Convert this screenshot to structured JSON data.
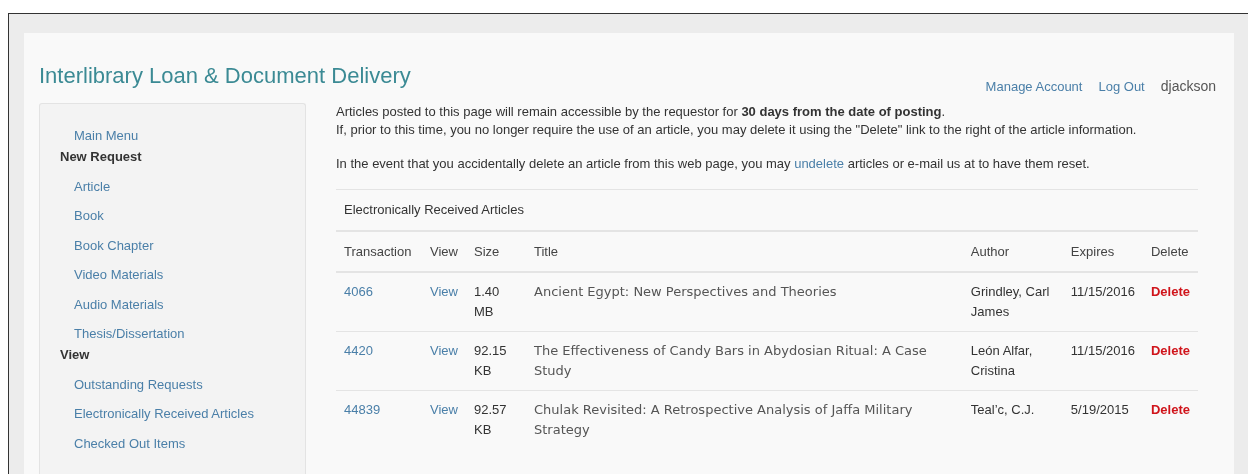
{
  "header": {
    "title": "Interlibrary Loan & Document Delivery",
    "account_links": [
      "Manage Account",
      "Log Out"
    ],
    "username": "djackson"
  },
  "sidebar": {
    "items": [
      {
        "kind": "link",
        "label": "Main Menu"
      },
      {
        "kind": "heading",
        "label": "New Request"
      },
      {
        "kind": "link",
        "label": "Article"
      },
      {
        "kind": "link",
        "label": "Book"
      },
      {
        "kind": "link",
        "label": "Book Chapter"
      },
      {
        "kind": "link",
        "label": "Video Materials"
      },
      {
        "kind": "link",
        "label": "Audio Materials"
      },
      {
        "kind": "link",
        "label": "Thesis/Dissertation"
      },
      {
        "kind": "heading",
        "label": "View"
      },
      {
        "kind": "link",
        "label": "Outstanding Requests"
      },
      {
        "kind": "link",
        "label": "Electronically Received Articles"
      },
      {
        "kind": "link",
        "label": "Checked Out Items"
      }
    ]
  },
  "intro": [
    "Articles posted to this page will remain accessible by the requestor for **30 days from the date of posting**.",
    "If, prior to this time, you no longer require the use of an article, you may delete it using the \"Delete\" link to the right of the article information."
  ],
  "notice": {
    "before": "In the event that you accidentally delete an article from this web page, you may",
    "link": "undelete",
    "after": "articles or e-mail us at to have them reset."
  },
  "table": {
    "caption": "Electronically Received Articles",
    "columns": [
      "Transaction",
      "View",
      "Size",
      "Title",
      "Author",
      "Expires",
      "Delete"
    ],
    "rows": [
      {
        "transaction": "4066",
        "view": "View",
        "size": "1.40 MB",
        "title": "Ancient Egypt: New Perspectives and Theories",
        "author": "Grindley, Carl James",
        "expires": "11/15/2016",
        "delete": "Delete"
      },
      {
        "transaction": "4420",
        "view": "View",
        "size": "92.15 KB",
        "title": "The Effectiveness of Candy Bars in Abydosian Ritual: A Case Study",
        "author": "León Alfar, Cristina",
        "expires": "11/15/2016",
        "delete": "Delete"
      },
      {
        "transaction": "44839",
        "view": "View",
        "size": "92.57 KB",
        "title": "Chulak Revisited: A Retrospective Analysis of Jaffa Military Strategy",
        "author": "Teal’c, C.J.",
        "expires": "5/19/2015",
        "delete": "Delete"
      }
    ]
  }
}
